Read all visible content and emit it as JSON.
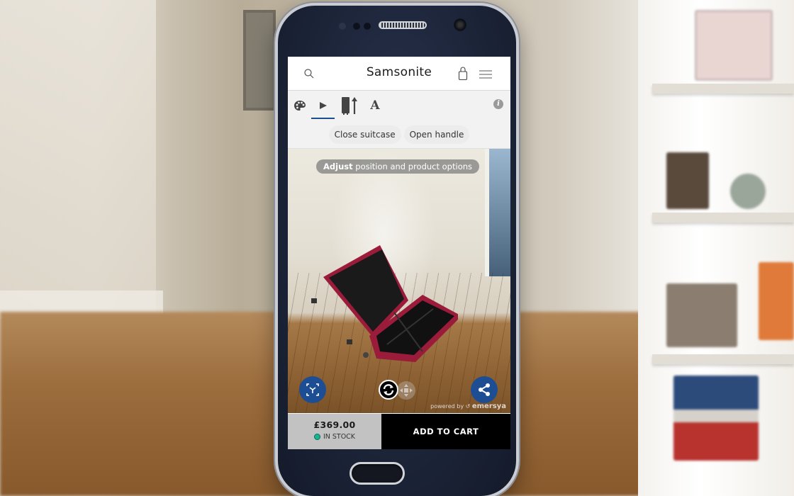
{
  "header": {
    "brand": "Samsonite",
    "icons": [
      "search-icon",
      "shopping-bag-icon",
      "hamburger-menu-icon"
    ]
  },
  "tabs": [
    {
      "name": "color-palette-icon",
      "active": false
    },
    {
      "name": "play-animation-icon",
      "active": true
    },
    {
      "name": "suitcase-handle-icon",
      "active": false
    },
    {
      "name": "text-personalize-icon",
      "active": false
    }
  ],
  "info_icon": "i",
  "options": [
    "Close suitcase",
    "Open handle"
  ],
  "viewer": {
    "hint_bold": "Adjust",
    "hint_rest": " position and product options",
    "powered_prefix": "powered by",
    "powered_brand": "emersya",
    "icons": [
      "ar-cube-icon",
      "rotate-icon",
      "move-icon",
      "share-icon"
    ]
  },
  "buybar": {
    "price": "£369.00",
    "stock": "IN STOCK",
    "stock_color": "#16b592",
    "add_to_cart": "ADD TO CART"
  },
  "colors": {
    "accent_blue": "#1d4e93",
    "suitcase_red": "#9b1b3a"
  }
}
